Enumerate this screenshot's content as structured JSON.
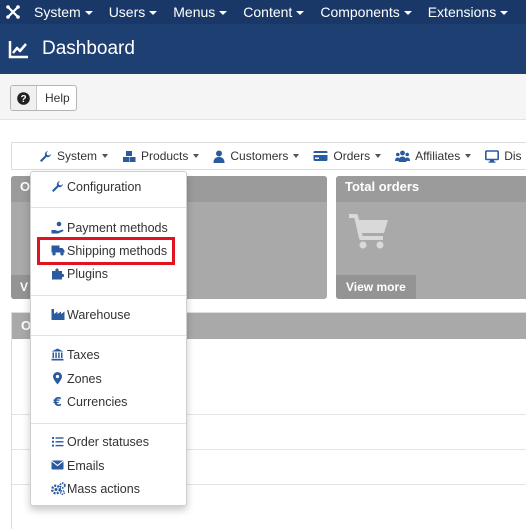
{
  "topbar": {
    "items": [
      {
        "label": "System"
      },
      {
        "label": "Users"
      },
      {
        "label": "Menus"
      },
      {
        "label": "Content"
      },
      {
        "label": "Components"
      },
      {
        "label": "Extensions"
      }
    ]
  },
  "header": {
    "title": "Dashboard"
  },
  "toolbar": {
    "help_label": "Help"
  },
  "compnav": {
    "items": [
      {
        "label": "System",
        "icon": "wrench-icon"
      },
      {
        "label": "Products",
        "icon": "cubes-icon"
      },
      {
        "label": "Customers",
        "icon": "user-icon"
      },
      {
        "label": "Orders",
        "icon": "credit-card-icon"
      },
      {
        "label": "Affiliates",
        "icon": "users-icon"
      },
      {
        "label": "Dis",
        "icon": "monitor-icon"
      }
    ]
  },
  "cards": {
    "left": {
      "title": "O",
      "view_more": "V"
    },
    "right": {
      "title": "Total orders",
      "view_more": "View more"
    }
  },
  "panel": {
    "title": "O"
  },
  "dropdown": {
    "items": [
      {
        "label": "Configuration",
        "icon": "wrench-icon"
      },
      {
        "label": "Payment methods",
        "icon": "hand-money-icon"
      },
      {
        "label": "Shipping methods",
        "icon": "truck-icon"
      },
      {
        "label": "Plugins",
        "icon": "puzzle-icon"
      },
      {
        "label": "Warehouse",
        "icon": "industry-icon"
      },
      {
        "label": "Taxes",
        "icon": "bank-icon"
      },
      {
        "label": "Zones",
        "icon": "map-marker-icon"
      },
      {
        "label": "Currencies",
        "icon": "euro-icon"
      },
      {
        "label": "Order statuses",
        "icon": "list-icon"
      },
      {
        "label": "Emails",
        "icon": "envelope-icon"
      },
      {
        "label": "Mass actions",
        "icon": "cogs-icon"
      }
    ]
  },
  "colors": {
    "topbar": "#1a3867",
    "header": "#1d3f72",
    "icon_blue": "#2a5aa0",
    "highlight": "#e0131e",
    "card_grey": "#a9a9a9"
  }
}
